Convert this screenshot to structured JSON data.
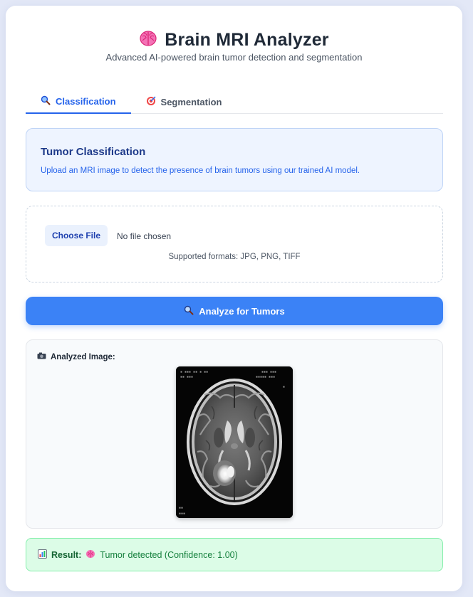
{
  "app": {
    "title": "Brain MRI Analyzer",
    "subtitle": "Advanced AI-powered brain tumor detection and segmentation",
    "title_icon": "brain-icon"
  },
  "tabs": [
    {
      "label": "Classification",
      "icon": "magnifier-icon",
      "active": true
    },
    {
      "label": "Segmentation",
      "icon": "target-icon",
      "active": false
    }
  ],
  "info": {
    "title": "Tumor Classification",
    "description": "Upload an MRI image to detect the presence of brain tumors using our trained AI model."
  },
  "upload": {
    "button_label": "Choose File",
    "status": "No file chosen",
    "formats": "Supported formats: JPG, PNG, TIFF"
  },
  "analyze": {
    "button_label": "Analyze for Tumors",
    "icon": "magnifier-icon"
  },
  "analyzed": {
    "label": "Analyzed Image:",
    "icon": "camera-icon"
  },
  "result": {
    "label": "Result:",
    "text": "Tumor detected (Confidence: 1.00)",
    "icon": "chart-icon",
    "badge_icon": "brain-icon"
  },
  "colors": {
    "accent": "#3b82f6",
    "active_tab": "#2563eb",
    "info_bg": "#eef4ff",
    "success_bg": "#dcfce7",
    "success_text": "#15803d"
  }
}
